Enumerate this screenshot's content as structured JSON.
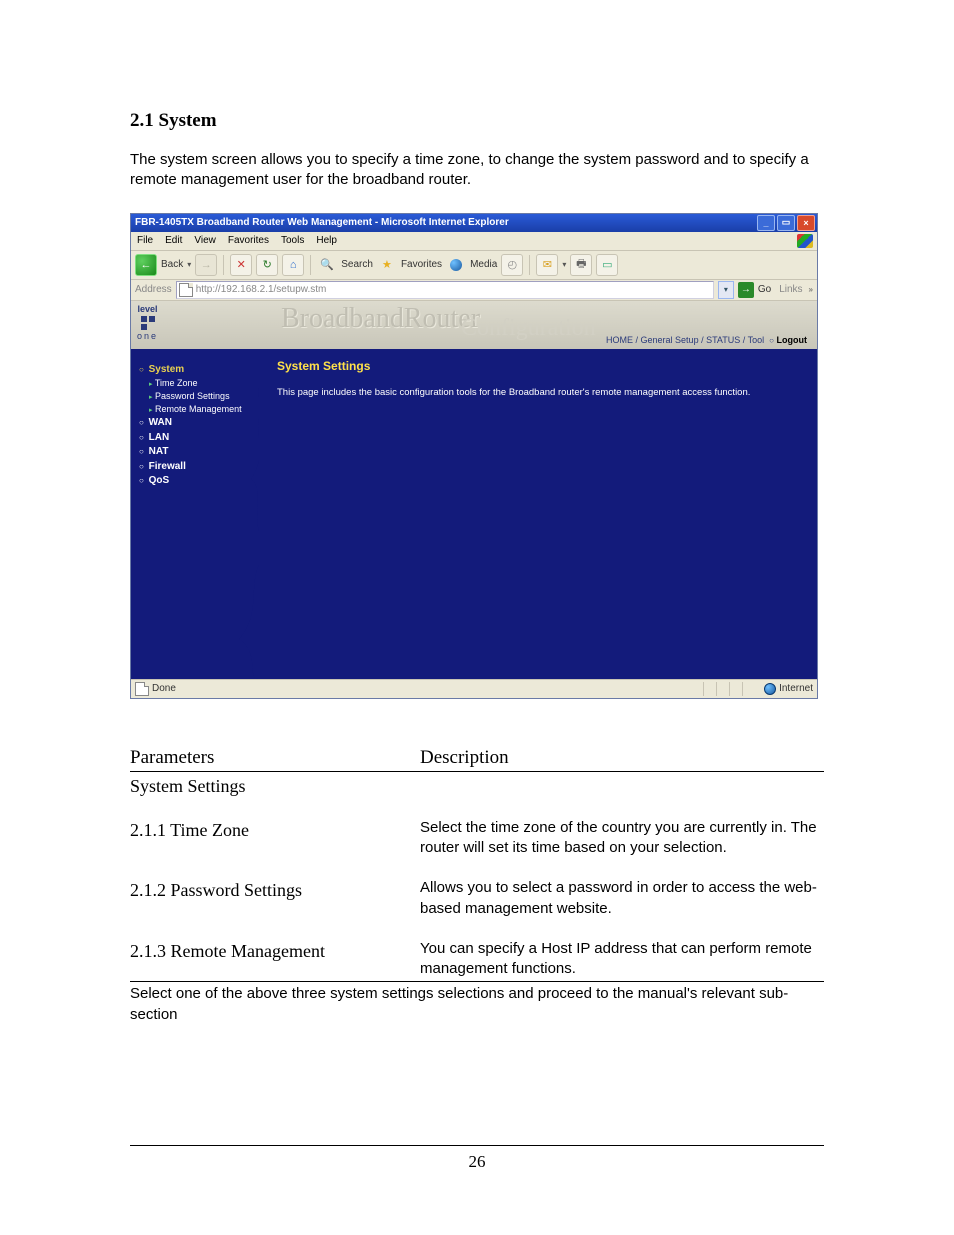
{
  "section": {
    "number_title": "2.1 System",
    "intro": "The system screen allows you to specify a time zone, to change the system password and to specify a remote management user for the broadband router."
  },
  "screenshot": {
    "window_title": "FBR-1405TX Broadband Router Web Management - Microsoft Internet Explorer",
    "menubar": [
      "File",
      "Edit",
      "View",
      "Favorites",
      "Tools",
      "Help"
    ],
    "toolbar": {
      "back": "Back",
      "search": "Search",
      "favorites": "Favorites",
      "media": "Media"
    },
    "address": {
      "label": "Address",
      "url": "http://192.168.2.1/setupw.stm",
      "go": "Go",
      "links": "Links"
    },
    "banner": {
      "logo_top": "level",
      "logo_bottom": "one",
      "big": "BroadbandRouter",
      "sub": "Configuration",
      "breadcrumb_home": "HOME",
      "breadcrumb_gs": "General Setup",
      "breadcrumb_status": "STATUS",
      "breadcrumb_tool": "Tool",
      "logout": "Logout"
    },
    "nav": {
      "system": "System",
      "time_zone": "Time Zone",
      "password_settings": "Password Settings",
      "remote_management": "Remote Management",
      "wan": "WAN",
      "lan": "LAN",
      "nat": "NAT",
      "firewall": "Firewall",
      "qos": "QoS"
    },
    "main": {
      "heading": "System Settings",
      "desc": "This page includes the basic configuration tools for the Broadband router's remote management access function."
    },
    "status": {
      "done": "Done",
      "zone": "Internet"
    }
  },
  "table": {
    "col_param": "Parameters",
    "col_desc": "Description",
    "subhead": "System Settings",
    "rows": [
      {
        "param": "2.1.1 Time Zone",
        "desc": "Select the time zone of the country you are currently in. The router will set its time based on your selection."
      },
      {
        "param": "2.1.2 Password Settings",
        "desc": "Allows you to select a password in order to access the web-based management website."
      },
      {
        "param": "2.1.3 Remote Management",
        "desc": "You can specify a Host IP address that can perform remote management functions."
      }
    ],
    "closing": "Select one of the above three system settings selections and proceed to the manual's relevant sub-section"
  },
  "page_number": "26"
}
